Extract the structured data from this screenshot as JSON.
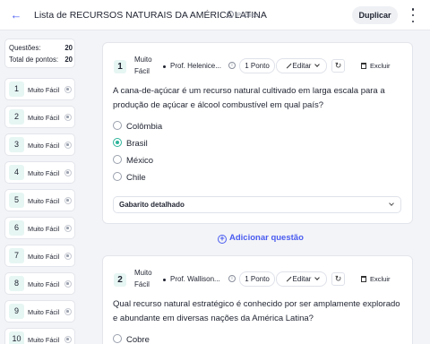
{
  "header": {
    "title": "Lista de RECURSOS NATURAIS DA AMÉRICA LATINA",
    "visibility": "Público",
    "duplicate_label": "Duplicar"
  },
  "summary": {
    "questions_label": "Questões:",
    "questions_count": "20",
    "points_label": "Total de pontos:",
    "points_count": "20"
  },
  "question_nav": [
    {
      "num": "1",
      "label": "Muito Fácil"
    },
    {
      "num": "2",
      "label": "Muito Fácil"
    },
    {
      "num": "3",
      "label": "Muito Fácil"
    },
    {
      "num": "4",
      "label": "Muito Fácil"
    },
    {
      "num": "5",
      "label": "Muito Fácil"
    },
    {
      "num": "6",
      "label": "Muito Fácil"
    },
    {
      "num": "7",
      "label": "Muito Fácil"
    },
    {
      "num": "8",
      "label": "Muito Fácil"
    },
    {
      "num": "9",
      "label": "Muito Fácil"
    },
    {
      "num": "10",
      "label": "Muito Fácil"
    }
  ],
  "questions": [
    {
      "num": "1",
      "difficulty_line1": "Muito",
      "difficulty_line2": "Fácil",
      "author": "Prof. Helenice...",
      "points": "1 Ponto",
      "edit_label": "Editar",
      "delete_label": "Excluir",
      "text": "A cana-de-açúcar é um recurso natural cultivado em larga escala para a produção de açúcar e álcool combustível em qual país?",
      "options": [
        "Colômbia",
        "Brasil",
        "México",
        "Chile"
      ],
      "selected_option": "Brasil",
      "answer_key_label": "Gabarito detalhado"
    },
    {
      "num": "2",
      "difficulty_line1": "Muito",
      "difficulty_line2": "Fácil",
      "author": "Prof. Wallison...",
      "points": "1 Ponto",
      "edit_label": "Editar",
      "delete_label": "Excluir",
      "text": "Qual recurso natural estratégico é conhecido por ser amplamente explorado e abundante em diversas nações da América Latina?",
      "options": [
        "Cobre"
      ]
    }
  ],
  "add_question_label": "Adicionar questão",
  "colors": {
    "accent": "#4a5cf0",
    "selected": "#2db49a",
    "badge_bg": "#e6f6f3"
  }
}
